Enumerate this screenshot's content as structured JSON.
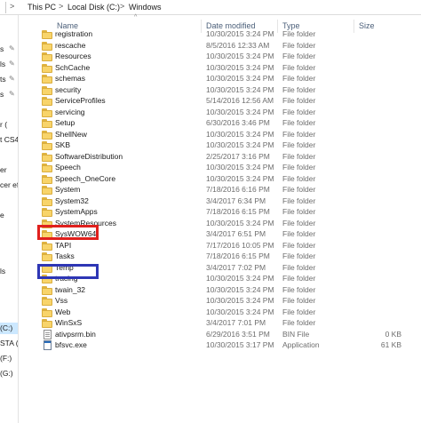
{
  "address_bar": {
    "crumbs": [
      "This PC",
      "Local Disk (C:)",
      "Windows"
    ],
    "separator": ">"
  },
  "nav_pane": {
    "items": [
      "s",
      "ls",
      "ts",
      "s",
      "r (",
      "t CS4",
      "er",
      "cer eff",
      "e",
      "ls",
      "(C:)",
      "STA (E",
      "(F:)",
      "(G:)"
    ],
    "selected": "(C:)"
  },
  "columns": {
    "name": "Name",
    "date": "Date modified",
    "type": "Type",
    "size": "Size"
  },
  "rows": [
    {
      "name": "registration",
      "date": "10/30/2015 3:24 PM",
      "type": "File folder",
      "size": "",
      "kind": "folder"
    },
    {
      "name": "rescache",
      "date": "8/5/2016 12:33 AM",
      "type": "File folder",
      "size": "",
      "kind": "folder"
    },
    {
      "name": "Resources",
      "date": "10/30/2015 3:24 PM",
      "type": "File folder",
      "size": "",
      "kind": "folder"
    },
    {
      "name": "SchCache",
      "date": "10/30/2015 3:24 PM",
      "type": "File folder",
      "size": "",
      "kind": "folder"
    },
    {
      "name": "schemas",
      "date": "10/30/2015 3:24 PM",
      "type": "File folder",
      "size": "",
      "kind": "folder"
    },
    {
      "name": "security",
      "date": "10/30/2015 3:24 PM",
      "type": "File folder",
      "size": "",
      "kind": "folder"
    },
    {
      "name": "ServiceProfiles",
      "date": "5/14/2016 12:56 AM",
      "type": "File folder",
      "size": "",
      "kind": "folder"
    },
    {
      "name": "servicing",
      "date": "10/30/2015 3:24 PM",
      "type": "File folder",
      "size": "",
      "kind": "folder"
    },
    {
      "name": "Setup",
      "date": "6/30/2016 3:46 PM",
      "type": "File folder",
      "size": "",
      "kind": "folder"
    },
    {
      "name": "ShellNew",
      "date": "10/30/2015 3:24 PM",
      "type": "File folder",
      "size": "",
      "kind": "folder"
    },
    {
      "name": "SKB",
      "date": "10/30/2015 3:24 PM",
      "type": "File folder",
      "size": "",
      "kind": "folder"
    },
    {
      "name": "SoftwareDistribution",
      "date": "2/25/2017 3:16 PM",
      "type": "File folder",
      "size": "",
      "kind": "folder"
    },
    {
      "name": "Speech",
      "date": "10/30/2015 3:24 PM",
      "type": "File folder",
      "size": "",
      "kind": "folder"
    },
    {
      "name": "Speech_OneCore",
      "date": "10/30/2015 3:24 PM",
      "type": "File folder",
      "size": "",
      "kind": "folder"
    },
    {
      "name": "System",
      "date": "7/18/2016 6:16 PM",
      "type": "File folder",
      "size": "",
      "kind": "folder"
    },
    {
      "name": "System32",
      "date": "3/4/2017 6:34 PM",
      "type": "File folder",
      "size": "",
      "kind": "folder"
    },
    {
      "name": "SystemApps",
      "date": "7/18/2016 6:15 PM",
      "type": "File folder",
      "size": "",
      "kind": "folder"
    },
    {
      "name": "SystemResources",
      "date": "10/30/2015 3:24 PM",
      "type": "File folder",
      "size": "",
      "kind": "folder"
    },
    {
      "name": "SysWOW64",
      "date": "3/4/2017 6:51 PM",
      "type": "File folder",
      "size": "",
      "kind": "folder"
    },
    {
      "name": "TAPI",
      "date": "7/17/2016 10:05 PM",
      "type": "File folder",
      "size": "",
      "kind": "folder"
    },
    {
      "name": "Tasks",
      "date": "7/18/2016 6:15 PM",
      "type": "File folder",
      "size": "",
      "kind": "folder"
    },
    {
      "name": "Temp",
      "date": "3/4/2017 7:02 PM",
      "type": "File folder",
      "size": "",
      "kind": "folder"
    },
    {
      "name": "tracing",
      "date": "10/30/2015 3:24 PM",
      "type": "File folder",
      "size": "",
      "kind": "folder"
    },
    {
      "name": "twain_32",
      "date": "10/30/2015 3:24 PM",
      "type": "File folder",
      "size": "",
      "kind": "folder"
    },
    {
      "name": "Vss",
      "date": "10/30/2015 3:24 PM",
      "type": "File folder",
      "size": "",
      "kind": "folder"
    },
    {
      "name": "Web",
      "date": "10/30/2015 3:24 PM",
      "type": "File folder",
      "size": "",
      "kind": "folder"
    },
    {
      "name": "WinSxS",
      "date": "3/4/2017 7:01 PM",
      "type": "File folder",
      "size": "",
      "kind": "folder"
    },
    {
      "name": "ativpsrm.bin",
      "date": "6/29/2016 3:51 PM",
      "type": "BIN File",
      "size": "0 KB",
      "kind": "bin"
    },
    {
      "name": "bfsvc.exe",
      "date": "10/30/2015 3:17 PM",
      "type": "Application",
      "size": "61 KB",
      "kind": "exe"
    }
  ],
  "highlights": {
    "red": {
      "label": "System32",
      "color": "#e0201d"
    },
    "blue": {
      "label": "SysWOW64",
      "color": "#2e36b5"
    }
  },
  "colors": {
    "header_text": "#4c607a",
    "folder": "#f8d46a",
    "nav_selected": "#cce8ff"
  }
}
